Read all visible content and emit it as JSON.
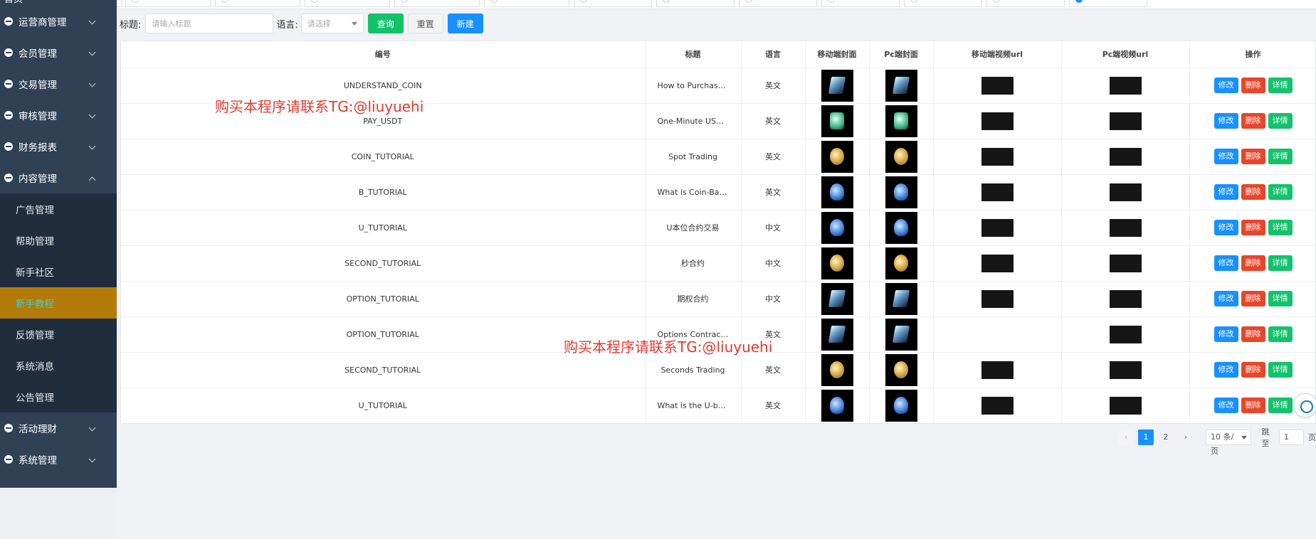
{
  "sidebar": {
    "top_label": "首页",
    "menus": [
      {
        "label": "运营商管理",
        "expanded": false
      },
      {
        "label": "会员管理",
        "expanded": false
      },
      {
        "label": "交易管理",
        "expanded": false
      },
      {
        "label": "审核管理",
        "expanded": false
      },
      {
        "label": "财务报表",
        "expanded": false
      },
      {
        "label": "内容管理",
        "expanded": true
      }
    ],
    "sub_items": [
      "广告管理",
      "帮助管理",
      "新手社区",
      "新手教程",
      "反馈管理",
      "系统消息",
      "公告管理"
    ],
    "active_sub": "新手教程",
    "bottom_menus": [
      {
        "label": "活动理财"
      },
      {
        "label": "系统管理"
      }
    ]
  },
  "filter": {
    "title_label": "标题:",
    "title_placeholder": "请输入标题",
    "lang_label": "语言:",
    "lang_placeholder": "请选择",
    "query_btn": "查询",
    "reset_btn": "重置",
    "new_btn": "新建"
  },
  "table": {
    "headers": [
      "编号",
      "标题",
      "语言",
      "移动端封面",
      "Pc端封面",
      "移动端视频url",
      "Pc端视频url",
      "操作"
    ],
    "rows": [
      {
        "code": "UNDERSTAND_COIN",
        "title": "How to Purchase ...",
        "lang": "英文",
        "thumb": "cube-icon",
        "mobile_url": true,
        "pc_url": true
      },
      {
        "code": "PAY_USDT",
        "title": "One-Minute USDT...",
        "lang": "英文",
        "thumb": "wallet-icon",
        "mobile_url": true,
        "pc_url": true
      },
      {
        "code": "COIN_TUTORIAL",
        "title": "Spot Trading",
        "lang": "英文",
        "thumb": "plant-coin-icon",
        "mobile_url": true,
        "pc_url": true
      },
      {
        "code": "B_TUTORIAL",
        "title": "What is Coin-Base...",
        "lang": "英文",
        "thumb": "flask-icon",
        "mobile_url": true,
        "pc_url": true
      },
      {
        "code": "U_TUTORIAL",
        "title": "U本位合约交易",
        "lang": "中文",
        "thumb": "flask-icon",
        "mobile_url": true,
        "pc_url": true
      },
      {
        "code": "SECOND_TUTORIAL",
        "title": "秒合约",
        "lang": "中文",
        "thumb": "clock-coin-icon",
        "mobile_url": true,
        "pc_url": true
      },
      {
        "code": "OPTION_TUTORIAL",
        "title": "期权合约",
        "lang": "中文",
        "thumb": "chart-book-icon",
        "mobile_url": true,
        "pc_url": true
      },
      {
        "code": "OPTION_TUTORIAL",
        "title": "Options Contract T...",
        "lang": "英文",
        "thumb": "chart-book-icon",
        "mobile_url": false,
        "pc_url": true
      },
      {
        "code": "SECOND_TUTORIAL",
        "title": "Seconds Trading",
        "lang": "英文",
        "thumb": "clock-coin-icon",
        "mobile_url": true,
        "pc_url": true
      },
      {
        "code": "U_TUTORIAL",
        "title": "What is the U-bas...",
        "lang": "英文",
        "thumb": "flask-icon",
        "mobile_url": true,
        "pc_url": true
      }
    ],
    "actions": {
      "edit": "修改",
      "delete": "删除",
      "detail": "详情"
    }
  },
  "watermark": "购买本程序请联系TG:@liuyuehi",
  "pagination": {
    "pages": [
      "1",
      "2"
    ],
    "current": "1",
    "page_size": "10 条/页",
    "jump_label": "跳至",
    "jump_value": "1",
    "page_suffix": "页"
  },
  "colors": {
    "primary": "#1890ff",
    "danger": "#e8452a",
    "success": "#13c26b",
    "sidebar": "#304156",
    "active_menu": "#b37b0a"
  }
}
